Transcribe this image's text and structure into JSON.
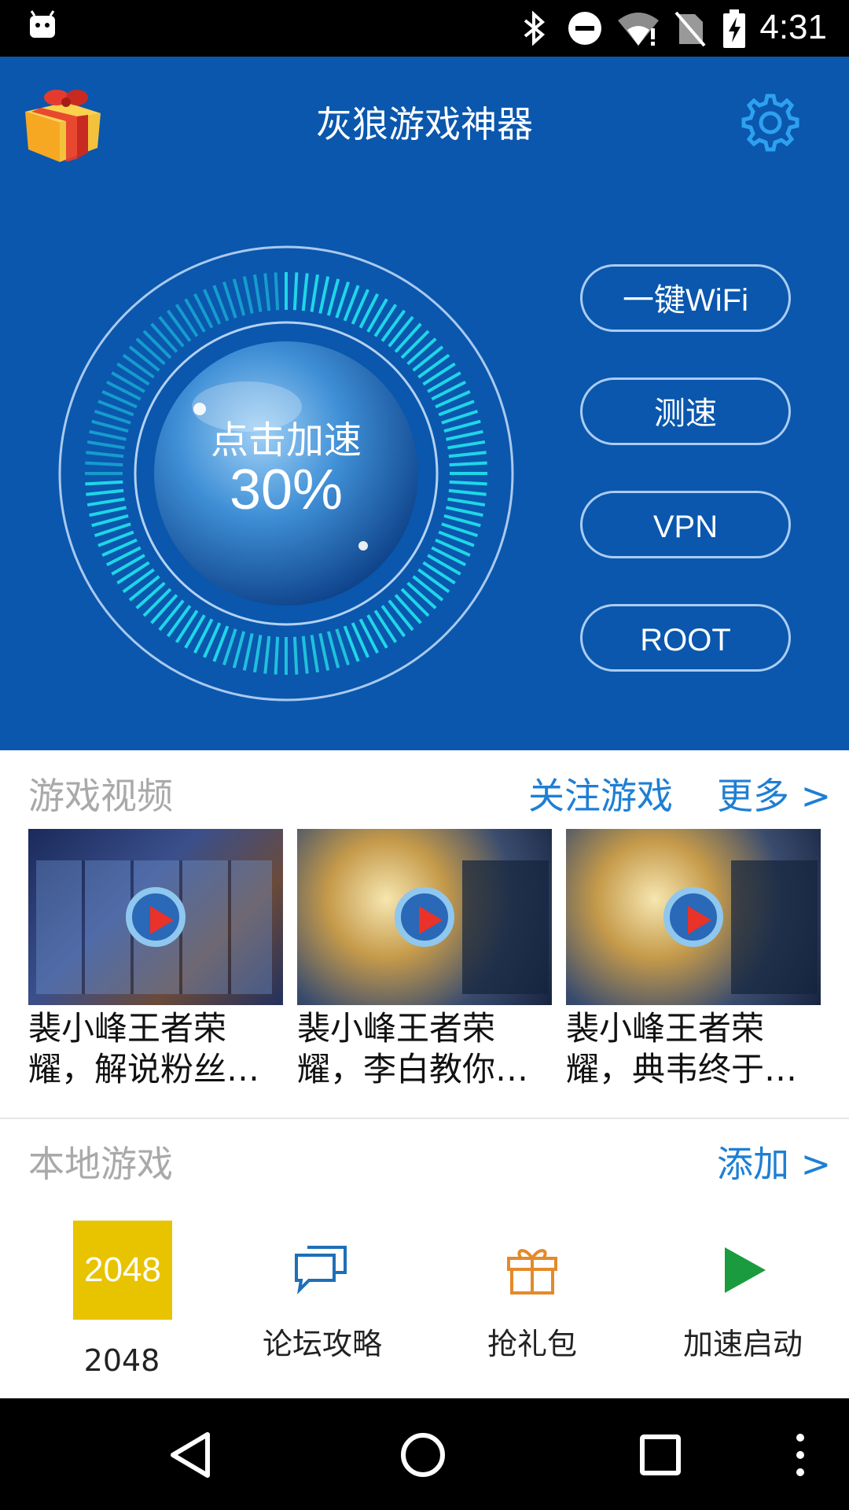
{
  "status_bar": {
    "time": "4:31"
  },
  "header": {
    "title": "灰狼游戏神器"
  },
  "gauge": {
    "label": "点击加速",
    "value": "30%",
    "progress": 0.3
  },
  "side_buttons": [
    "一键WiFi",
    "测速",
    "VPN",
    "ROOT"
  ],
  "videos_section": {
    "title": "游戏视频",
    "follow_link": "关注游戏",
    "more_link": "更多 >",
    "items": [
      {
        "title": "裴小峰王者荣耀，解说粉丝回…"
      },
      {
        "title": "裴小峰王者荣耀，李白教你用…"
      },
      {
        "title": "裴小峰王者荣耀，典韦终于来…"
      }
    ]
  },
  "local_section": {
    "title": "本地游戏",
    "add_link": "添加 >",
    "tiles": [
      {
        "label": "2048",
        "badge": "2048",
        "icon": "game-2048-icon"
      },
      {
        "label": "论坛攻略",
        "icon": "forum-chat-icon"
      },
      {
        "label": "抢礼包",
        "icon": "gift-icon"
      },
      {
        "label": "加速启动",
        "icon": "play-icon"
      }
    ]
  },
  "colors": {
    "hero_bg": "#0a57ad",
    "accent_cyan": "#1fd6e8",
    "link_blue": "#1e7fd4",
    "tile_yellow": "#e8c300",
    "play_green": "#1a9c3e",
    "gift_orange": "#e48a2a"
  }
}
